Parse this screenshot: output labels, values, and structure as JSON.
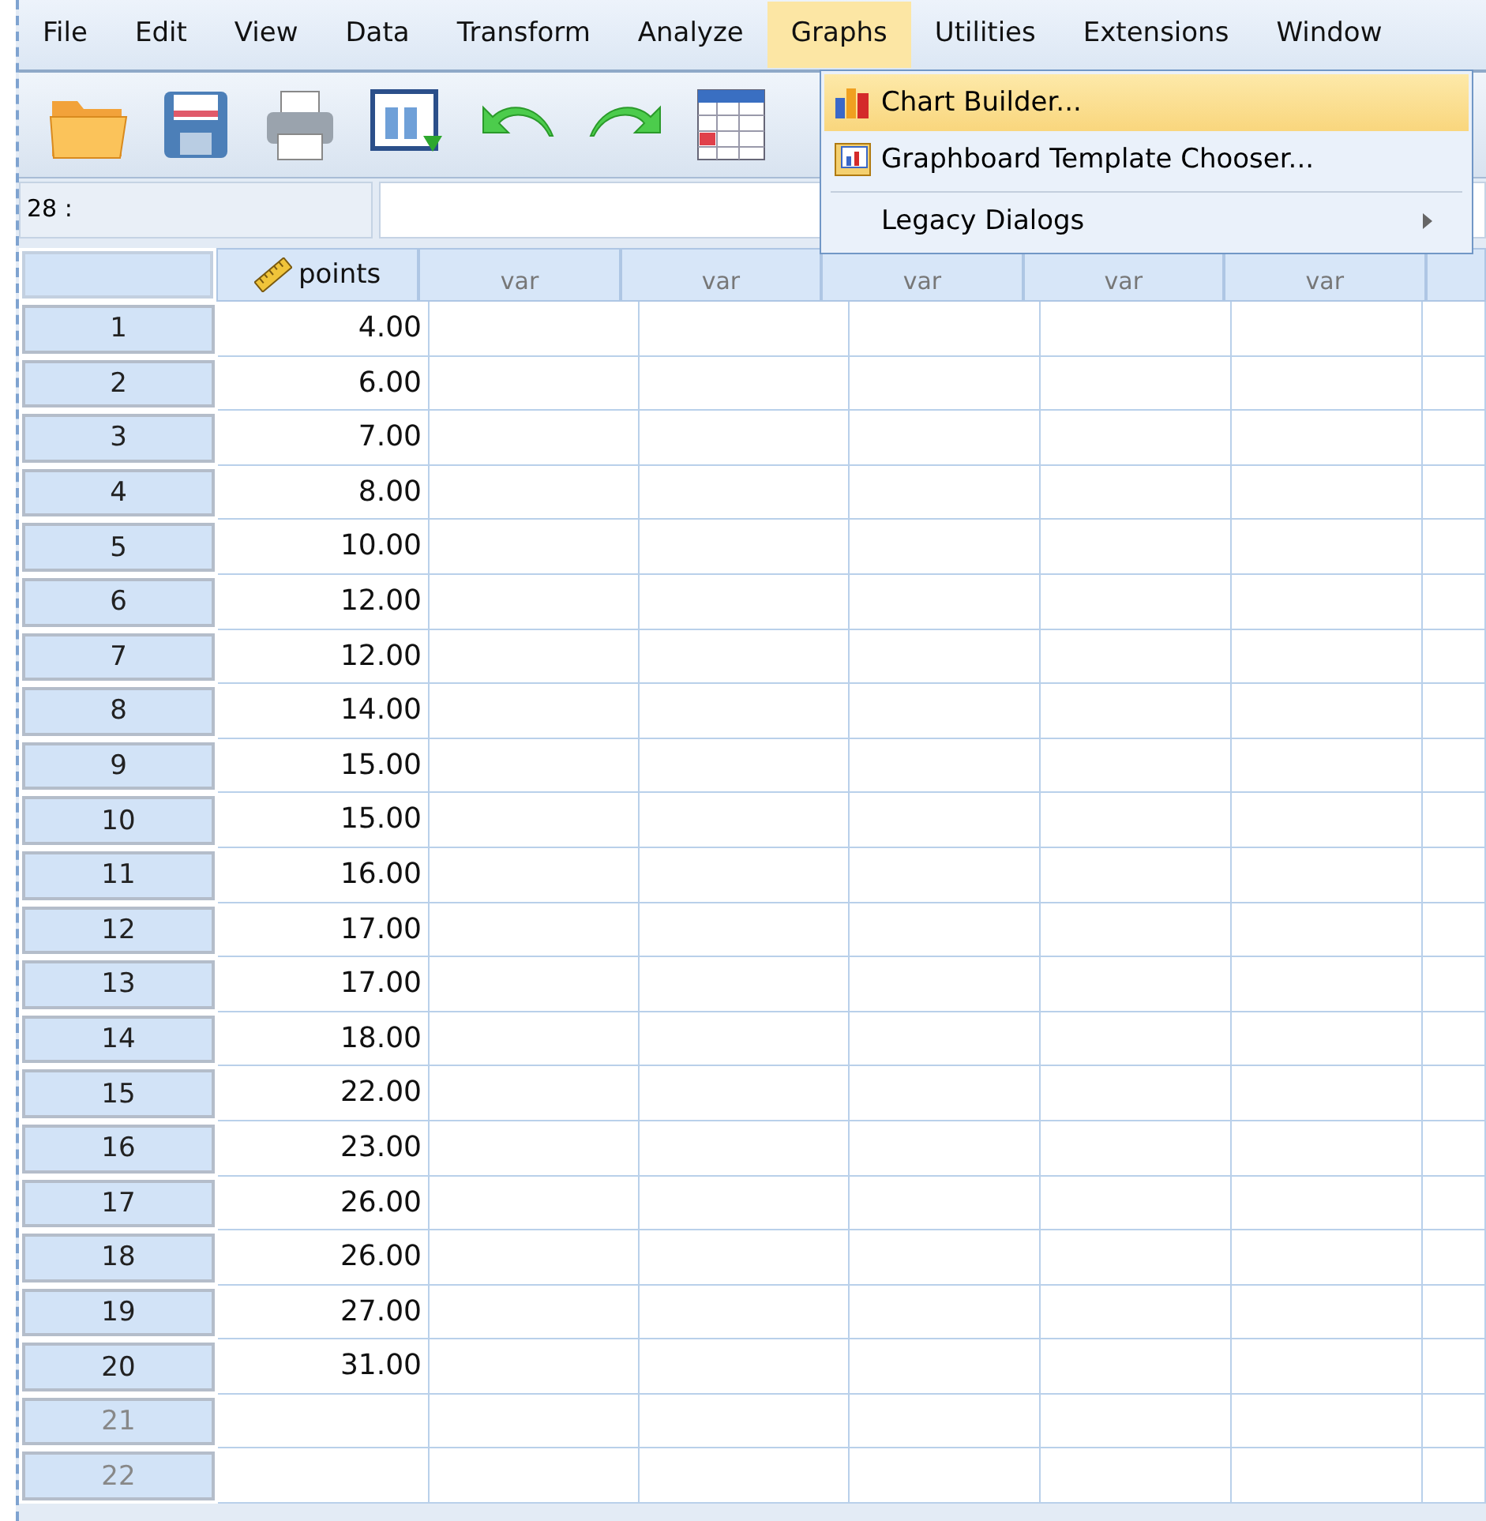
{
  "menu_bar": [
    {
      "label": "File",
      "selected": false
    },
    {
      "label": "Edit",
      "selected": false
    },
    {
      "label": "View",
      "selected": false
    },
    {
      "label": "Data",
      "selected": false
    },
    {
      "label": "Transform",
      "selected": false
    },
    {
      "label": "Analyze",
      "selected": false
    },
    {
      "label": "Graphs",
      "selected": true
    },
    {
      "label": "Utilities",
      "selected": false
    },
    {
      "label": "Extensions",
      "selected": false
    },
    {
      "label": "Window",
      "selected": false
    }
  ],
  "cell_reference": "28 :",
  "grid": {
    "columns": [
      {
        "label": "points",
        "kind": "variable"
      },
      {
        "label": "var",
        "kind": "empty"
      },
      {
        "label": "var",
        "kind": "empty"
      },
      {
        "label": "var",
        "kind": "empty"
      },
      {
        "label": "var",
        "kind": "empty"
      },
      {
        "label": "var",
        "kind": "empty"
      }
    ],
    "rows": [
      {
        "case": "1",
        "value": "4.00",
        "empty": false
      },
      {
        "case": "2",
        "value": "6.00",
        "empty": false
      },
      {
        "case": "3",
        "value": "7.00",
        "empty": false
      },
      {
        "case": "4",
        "value": "8.00",
        "empty": false
      },
      {
        "case": "5",
        "value": "10.00",
        "empty": false
      },
      {
        "case": "6",
        "value": "12.00",
        "empty": false
      },
      {
        "case": "7",
        "value": "12.00",
        "empty": false
      },
      {
        "case": "8",
        "value": "14.00",
        "empty": false
      },
      {
        "case": "9",
        "value": "15.00",
        "empty": false
      },
      {
        "case": "10",
        "value": "15.00",
        "empty": false
      },
      {
        "case": "11",
        "value": "16.00",
        "empty": false
      },
      {
        "case": "12",
        "value": "17.00",
        "empty": false
      },
      {
        "case": "13",
        "value": "17.00",
        "empty": false
      },
      {
        "case": "14",
        "value": "18.00",
        "empty": false
      },
      {
        "case": "15",
        "value": "22.00",
        "empty": false
      },
      {
        "case": "16",
        "value": "23.00",
        "empty": false
      },
      {
        "case": "17",
        "value": "26.00",
        "empty": false
      },
      {
        "case": "18",
        "value": "26.00",
        "empty": false
      },
      {
        "case": "19",
        "value": "27.00",
        "empty": false
      },
      {
        "case": "20",
        "value": "31.00",
        "empty": false
      },
      {
        "case": "21",
        "empty": true
      },
      {
        "case": "22",
        "empty": true
      }
    ]
  },
  "graphs_menu": {
    "items": [
      {
        "label": "Chart Builder...",
        "kind": "chart",
        "selected": true
      },
      {
        "label": "Graphboard Template Chooser...",
        "kind": "graphboard",
        "selected": false
      },
      {
        "label": "Legacy Dialogs",
        "kind": "submenu",
        "selected": false
      }
    ]
  }
}
